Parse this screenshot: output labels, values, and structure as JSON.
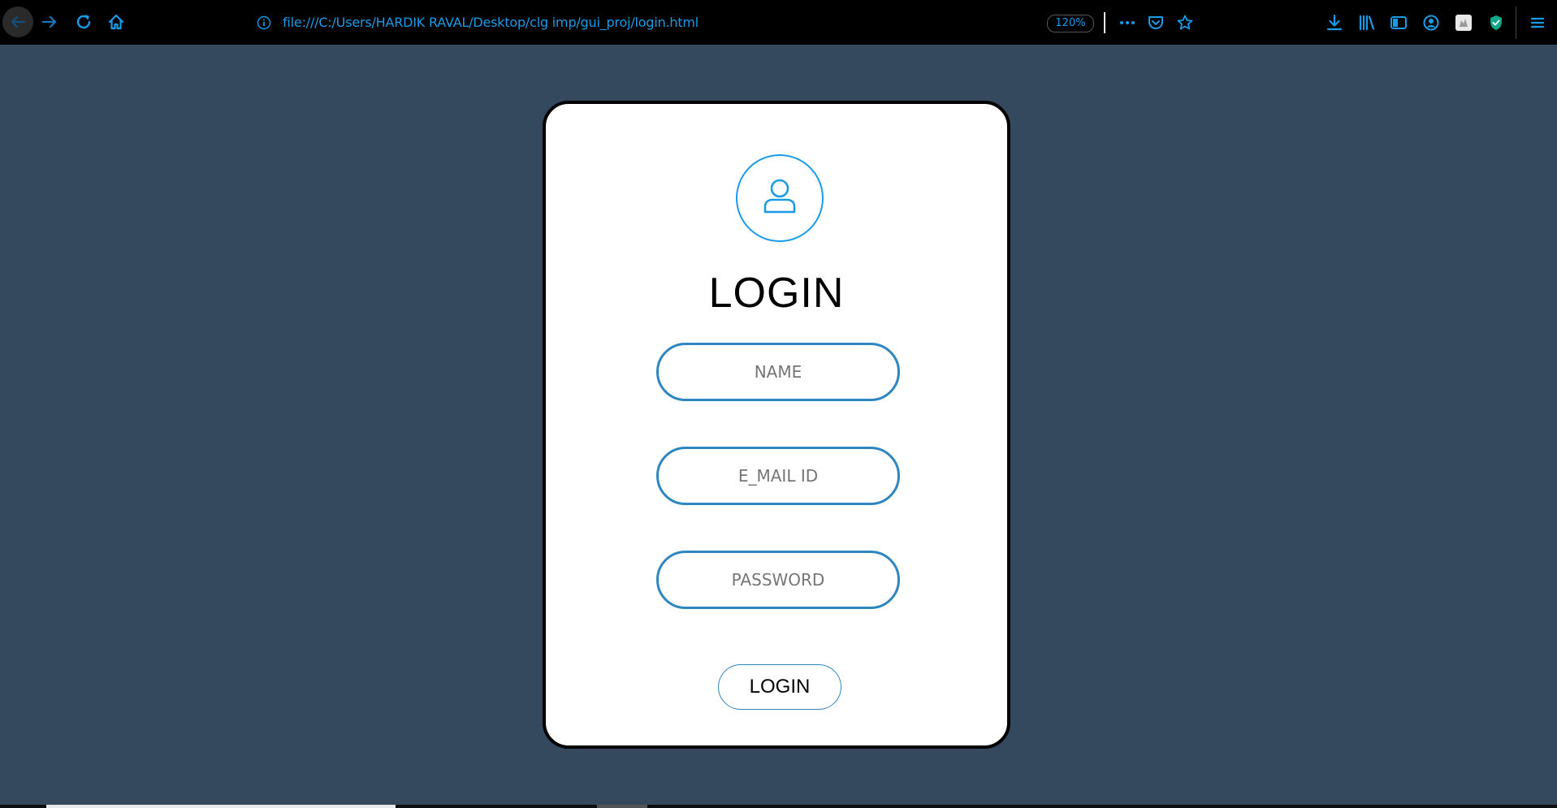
{
  "browser": {
    "url": "file:///C:/Users/HARDIK RAVAL/Desktop/clg imp/gui_proj/login.html",
    "zoom_level": "120%",
    "accent_color": "#1a9be8",
    "toolbar_icons": [
      "back-arrow-icon",
      "forward-arrow-icon",
      "reload-icon",
      "home-icon",
      "info-icon",
      "more-icon",
      "pocket-icon",
      "bookmark-star-icon",
      "download-icon",
      "library-icon",
      "sidebar-icon",
      "account-icon",
      "extension-icon",
      "shield-icon",
      "menu-icon"
    ]
  },
  "page": {
    "background_color": "#34495e",
    "card": {
      "avatar_icon": "user-icon",
      "title": "LOGIN",
      "fields": {
        "name_placeholder": "NAME",
        "email_placeholder": "E_MAIL ID",
        "password_placeholder": "PASSWORD"
      },
      "login_button_label": "LOGIN",
      "field_border_color": "#2e86c1"
    }
  }
}
